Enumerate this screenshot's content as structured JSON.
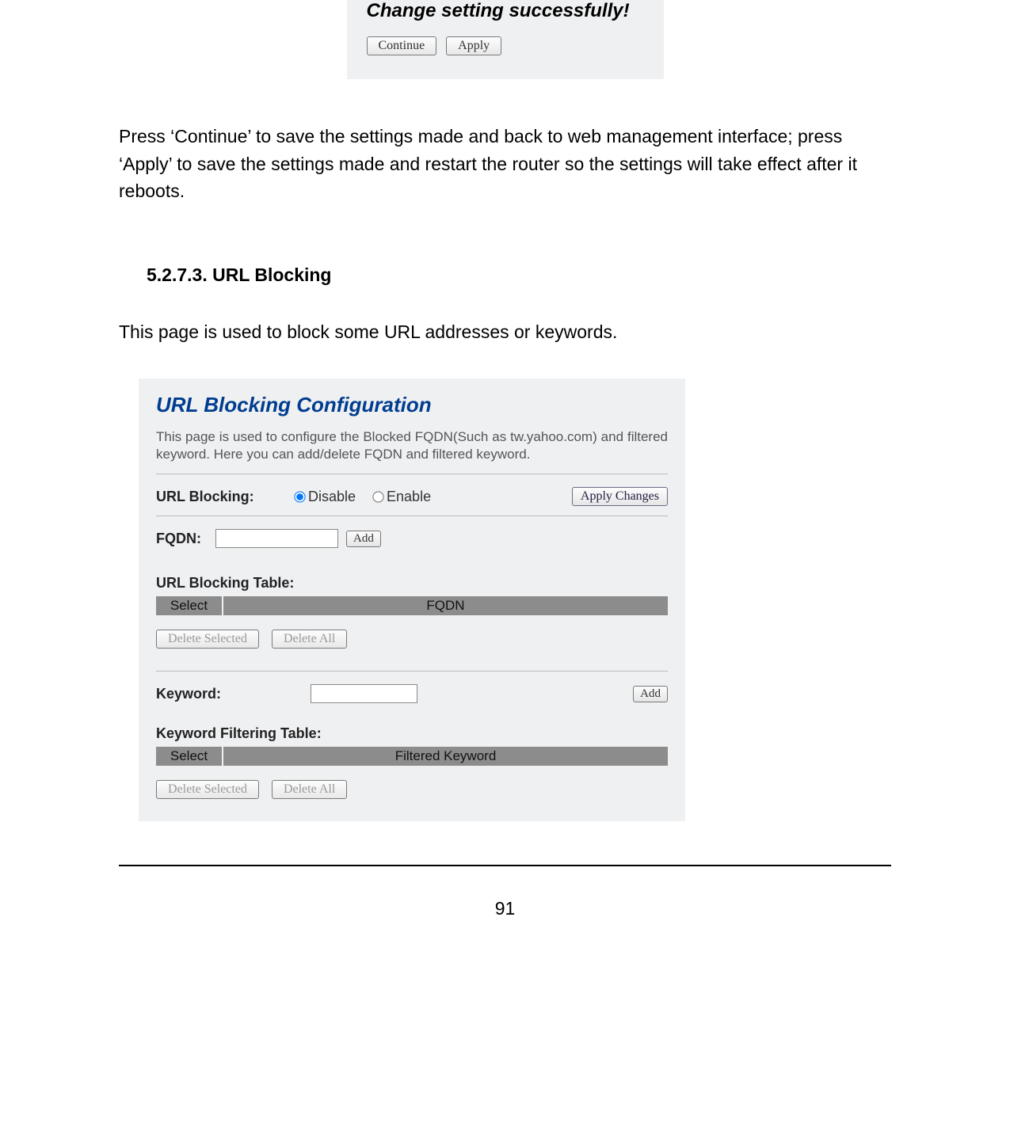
{
  "success_panel": {
    "title": "Change setting successfully!",
    "continue_label": "Continue",
    "apply_label": "Apply"
  },
  "body_paragraph": "Press ‘Continue’ to save the settings made and back to web management interface; press ‘Apply’ to save the settings made and restart the router so the settings will take effect after it reboots.",
  "section": {
    "heading": "5.2.7.3. URL Blocking",
    "intro": "This page is used to block some URL addresses or keywords."
  },
  "config": {
    "title": "URL Blocking Configuration",
    "description": "This page is used to configure the Blocked FQDN(Such as tw.yahoo.com) and filtered keyword. Here you can add/delete FQDN and filtered keyword.",
    "url_blocking_label": "URL Blocking:",
    "disable_label": "Disable",
    "enable_label": "Enable",
    "apply_changes_label": "Apply Changes",
    "fqdn_label": "FQDN:",
    "add_label": "Add",
    "url_table_title": "URL Blocking Table:",
    "col_select": "Select",
    "col_fqdn": "FQDN",
    "delete_selected_label": "Delete Selected",
    "delete_all_label": "Delete All",
    "keyword_label": "Keyword:",
    "keyword_table_title": "Keyword Filtering Table:",
    "col_filtered_keyword": "Filtered Keyword"
  },
  "page_number": "91"
}
